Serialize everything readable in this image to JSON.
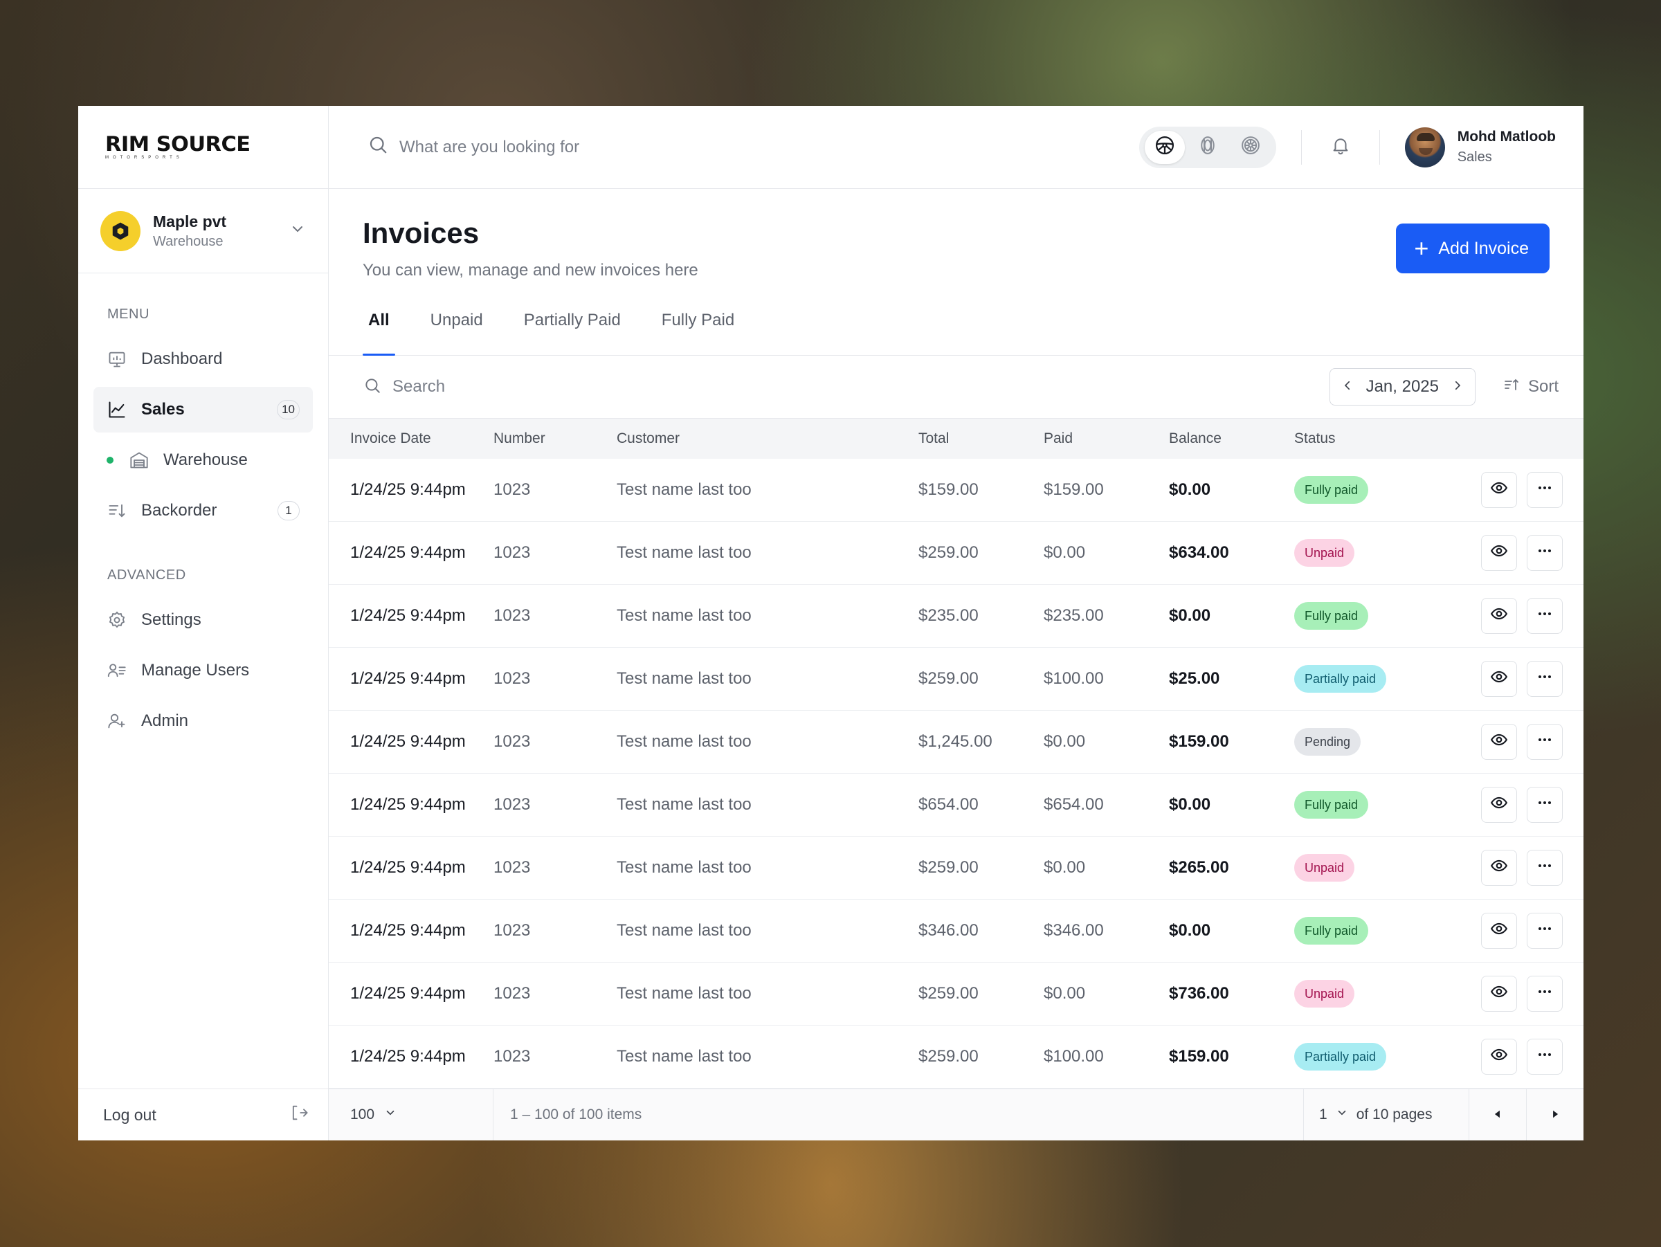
{
  "brand": {
    "name": "RIM SOURCE",
    "tagline": "MOTORSPORTS"
  },
  "org": {
    "name": "Maple pvt",
    "type": "Warehouse"
  },
  "sidebar": {
    "menu_label": "MENU",
    "advanced_label": "ADVANCED",
    "items": [
      {
        "label": "Dashboard",
        "icon": "presentation-chart-icon"
      },
      {
        "label": "Sales",
        "icon": "line-chart-icon",
        "count": "10",
        "active": true
      },
      {
        "label": "Warehouse",
        "icon": "warehouse-icon",
        "status_dot": "#1fb36a"
      },
      {
        "label": "Backorder",
        "icon": "sort-list-icon",
        "count": "1"
      }
    ],
    "advanced_items": [
      {
        "label": "Settings",
        "icon": "gear-icon"
      },
      {
        "label": "Manage Users",
        "icon": "users-list-icon"
      },
      {
        "label": "Admin",
        "icon": "user-plus-icon"
      }
    ],
    "logout_label": "Log out"
  },
  "topbar": {
    "search_placeholder": "What are you looking for",
    "modes": [
      "steering-wheel-icon",
      "tire-icon",
      "rim-icon"
    ],
    "user": {
      "name": "Mohd Matloob",
      "role": "Sales"
    }
  },
  "page": {
    "title": "Invoices",
    "subtitle": "You can view, manage and new invoices here",
    "add_label": "Add Invoice",
    "accent": "#1a5cf5"
  },
  "tabs": [
    "All",
    "Unpaid",
    "Partially Paid",
    "Fully Paid"
  ],
  "filters": {
    "search_placeholder": "Search",
    "period": "Jan, 2025",
    "sort_label": "Sort"
  },
  "table": {
    "columns": [
      "Invoice Date",
      "Number",
      "Customer",
      "Total",
      "Paid",
      "Balance",
      "Status"
    ],
    "rows": [
      {
        "date": "1/24/25 9:44pm",
        "number": "1023",
        "customer": "Test name last too",
        "total": "$159.00",
        "paid": "$159.00",
        "balance": "$0.00",
        "status": "Fully paid",
        "kind": "fully"
      },
      {
        "date": "1/24/25 9:44pm",
        "number": "1023",
        "customer": "Test name last too",
        "total": "$259.00",
        "paid": "$0.00",
        "balance": "$634.00",
        "status": "Unpaid",
        "kind": "unpaid"
      },
      {
        "date": "1/24/25 9:44pm",
        "number": "1023",
        "customer": "Test name last too",
        "total": "$235.00",
        "paid": "$235.00",
        "balance": "$0.00",
        "status": "Fully paid",
        "kind": "fully"
      },
      {
        "date": "1/24/25 9:44pm",
        "number": "1023",
        "customer": "Test name last too",
        "total": "$259.00",
        "paid": "$100.00",
        "balance": "$25.00",
        "status": "Partially paid",
        "kind": "partial"
      },
      {
        "date": "1/24/25 9:44pm",
        "number": "1023",
        "customer": "Test name last too",
        "total": "$1,245.00",
        "paid": "$0.00",
        "balance": "$159.00",
        "status": "Pending",
        "kind": "pending"
      },
      {
        "date": "1/24/25 9:44pm",
        "number": "1023",
        "customer": "Test name last too",
        "total": "$654.00",
        "paid": "$654.00",
        "balance": "$0.00",
        "status": "Fully paid",
        "kind": "fully"
      },
      {
        "date": "1/24/25 9:44pm",
        "number": "1023",
        "customer": "Test name last too",
        "total": "$259.00",
        "paid": "$0.00",
        "balance": "$265.00",
        "status": "Unpaid",
        "kind": "unpaid"
      },
      {
        "date": "1/24/25 9:44pm",
        "number": "1023",
        "customer": "Test name last too",
        "total": "$346.00",
        "paid": "$346.00",
        "balance": "$0.00",
        "status": "Fully paid",
        "kind": "fully"
      },
      {
        "date": "1/24/25 9:44pm",
        "number": "1023",
        "customer": "Test name last too",
        "total": "$259.00",
        "paid": "$0.00",
        "balance": "$736.00",
        "status": "Unpaid",
        "kind": "unpaid"
      },
      {
        "date": "1/24/25 9:44pm",
        "number": "1023",
        "customer": "Test name last too",
        "total": "$259.00",
        "paid": "$100.00",
        "balance": "$159.00",
        "status": "Partially paid",
        "kind": "partial"
      }
    ]
  },
  "pagination": {
    "per_page": "100",
    "range": "1 – 100 of 100 items",
    "current_page": "1",
    "of_pages": "of 10 pages"
  }
}
